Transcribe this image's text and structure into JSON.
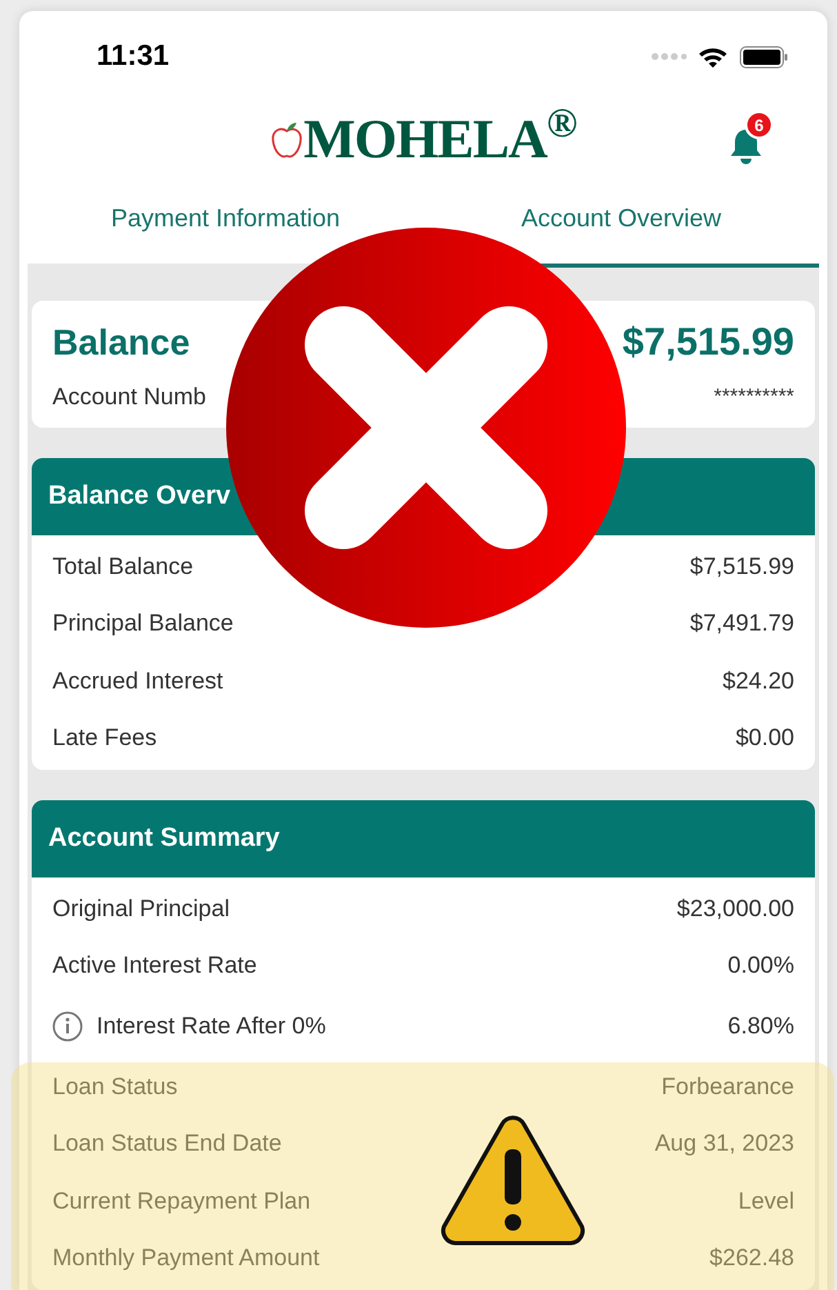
{
  "status_bar": {
    "time": "11:31"
  },
  "header": {
    "logo": "MOHELA$^{®}$",
    "notification_count": "6"
  },
  "tabs": [
    {
      "label": "Payment Information",
      "selected": false
    },
    {
      "label": "Account Overview",
      "selected": true
    }
  ],
  "balance_card": {
    "title": "Balance",
    "amount": "$7,515.99",
    "account_label": "Account Numb",
    "account_value": "**********"
  },
  "sections": [
    {
      "title": "Balance Overv",
      "rows": [
        {
          "kind": "plain",
          "label": "Total Balance",
          "value": "$7,515.99"
        },
        {
          "kind": "plain",
          "label": "Principal Balance",
          "value": "$7,491.79"
        },
        {
          "kind": "plain",
          "label": "Accrued Interest",
          "value": "$24.20"
        },
        {
          "kind": "plain",
          "label": "Late Fees",
          "value": "$0.00"
        }
      ]
    },
    {
      "title": "Account Summary",
      "rows": [
        {
          "kind": "plain",
          "label": "Original Principal",
          "value": "$23,000.00"
        },
        {
          "kind": "plain",
          "label": "Active Interest Rate",
          "value": "0.00%"
        },
        {
          "kind": "info",
          "label": "Interest Rate After 0%",
          "value": "6.80%"
        },
        {
          "kind": "plain",
          "label": "Loan Status",
          "value": "Forbearance"
        },
        {
          "kind": "plain",
          "label": "Loan Status End Date",
          "value": "Aug 31, 2023"
        },
        {
          "kind": "plain",
          "label": "Current Repayment Plan",
          "value": "Level"
        },
        {
          "kind": "plain",
          "label": "Monthly Payment Amount",
          "value": "$262.48"
        }
      ]
    }
  ]
}
